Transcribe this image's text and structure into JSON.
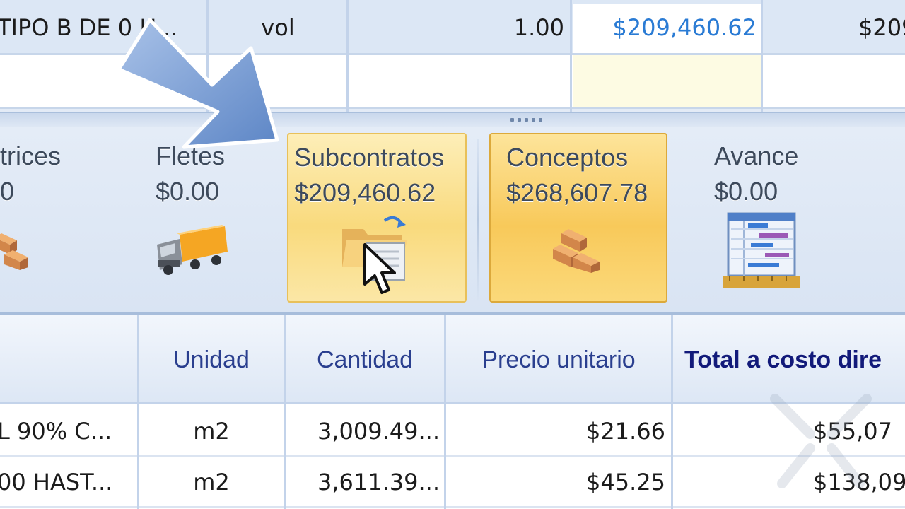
{
  "top_row": {
    "description": "TIPO B DE 0 H...",
    "unit": "vol",
    "quantity": "1.00",
    "unit_price": "$209,460.62",
    "total_partial": "$209"
  },
  "summary_tiles": [
    {
      "title": "trices",
      "value": "0",
      "icon": "bricks-icon",
      "state": "normal"
    },
    {
      "title": "Fletes",
      "value": "$0.00",
      "icon": "truck-icon",
      "state": "normal"
    },
    {
      "title": "Subcontratos",
      "value": "$209,460.62",
      "icon": "folder-document-icon",
      "state": "hover"
    },
    {
      "title": "Conceptos",
      "value": "$268,607.78",
      "icon": "bricks-icon",
      "state": "selected"
    },
    {
      "title": "Avance",
      "value": "$0.00",
      "icon": "schedule-gantt-icon",
      "state": "normal"
    }
  ],
  "table": {
    "headers": [
      "",
      "Unidad",
      "Cantidad",
      "Precio unitario",
      "Total a costo dire"
    ],
    "rows": [
      {
        "description": "L 90% C...",
        "unit": "m2",
        "quantity": "3,009.49...",
        "unit_price": "$21.66",
        "total": "$55,07"
      },
      {
        "description": "00 HAST...",
        "unit": "m2",
        "quantity": "3,611.39...",
        "unit_price": "$45.25",
        "total": "$138,09"
      }
    ]
  },
  "colors": {
    "accent_blue_text": "#2a7bd4",
    "header_text": "#2a3f8f",
    "selected_tile": "#f8c95a",
    "hover_tile": "#f9da7d"
  }
}
